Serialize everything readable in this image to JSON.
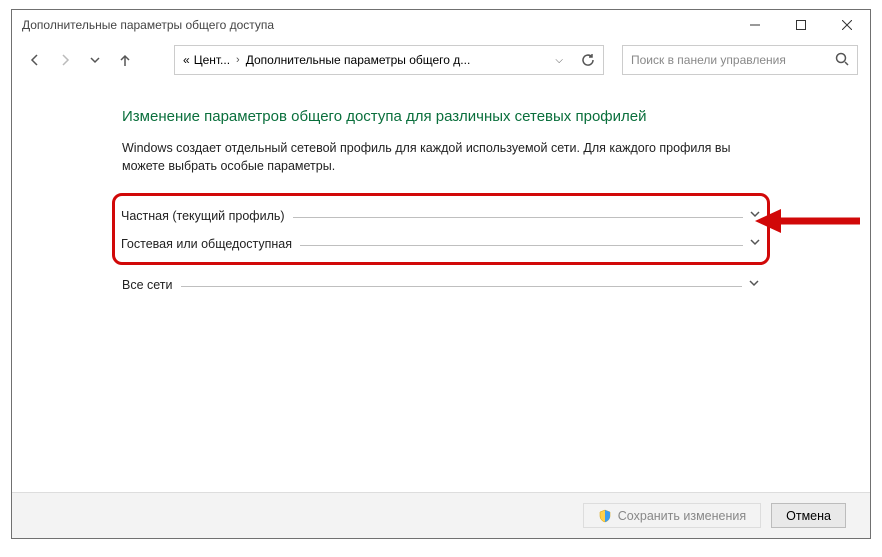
{
  "window": {
    "title": "Дополнительные параметры общего доступа"
  },
  "breadcrumb": {
    "prefix": "«",
    "item1": "Цент...",
    "item2": "Дополнительные параметры общего д..."
  },
  "search": {
    "placeholder": "Поиск в панели управления"
  },
  "page": {
    "heading": "Изменение параметров общего доступа для различных сетевых профилей",
    "description": "Windows создает отдельный сетевой профиль для каждой используемой сети. Для каждого профиля вы можете выбрать особые параметры."
  },
  "sections": {
    "private": "Частная (текущий профиль)",
    "guest": "Гостевая или общедоступная",
    "all": "Все сети"
  },
  "buttons": {
    "save": "Сохранить изменения",
    "cancel": "Отмена"
  }
}
